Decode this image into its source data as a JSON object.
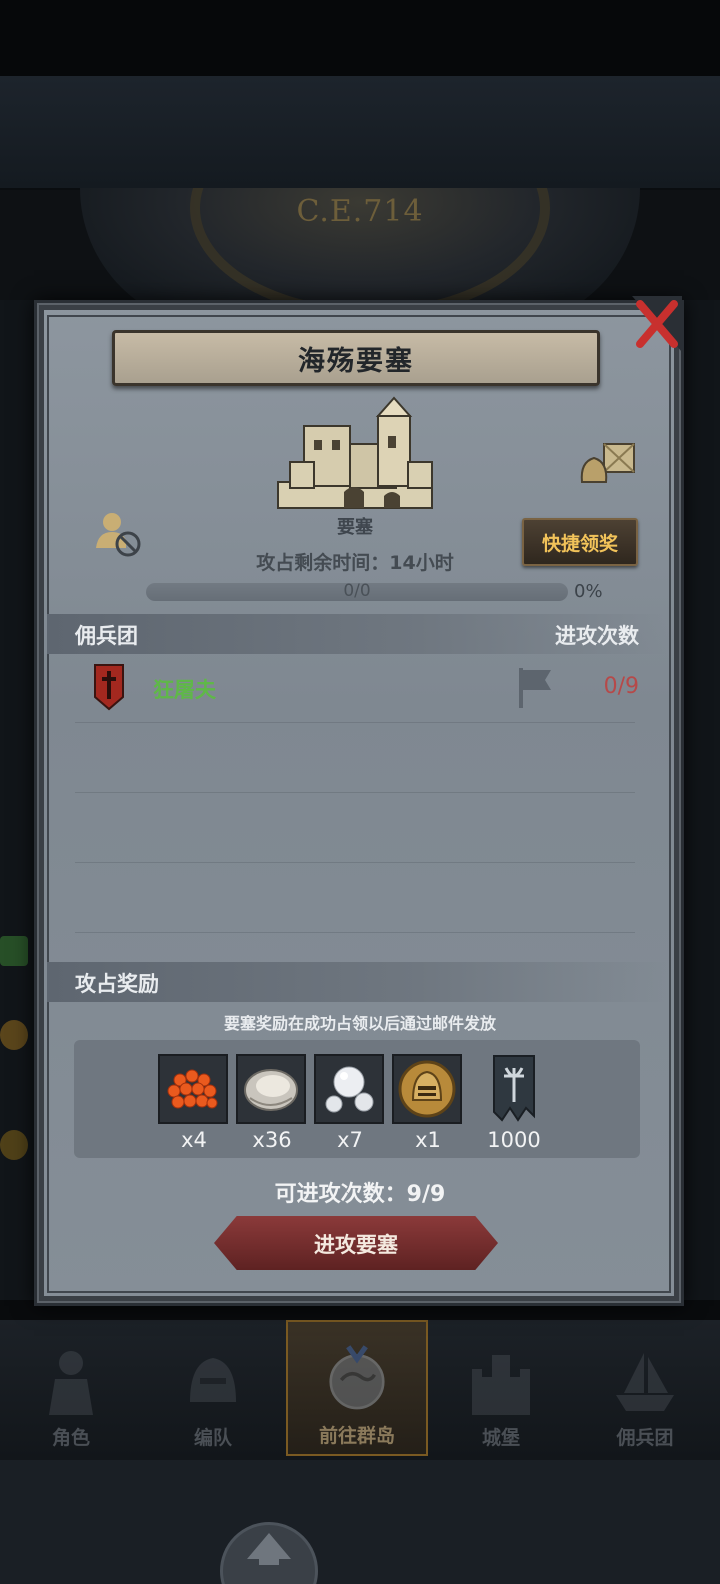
{
  "background": {
    "year_label": "C.E.714"
  },
  "nav": {
    "items": [
      {
        "label": "角色",
        "active": false
      },
      {
        "label": "编队",
        "active": false
      },
      {
        "label": "前往群岛",
        "active": true
      },
      {
        "label": "城堡",
        "active": false
      },
      {
        "label": "佣兵团",
        "active": false
      }
    ]
  },
  "modal": {
    "title": "海殇要塞",
    "castle_type": "要塞",
    "claim_button": "快捷领奖",
    "time_remaining": "攻占剩余时间：14小时",
    "progress": {
      "text": "0/0",
      "percent_label": "0%",
      "fraction": 0
    },
    "mercenary_section": {
      "title": "佣兵团",
      "right_title": "进攻次数",
      "rows": [
        {
          "name": "狂屠夫",
          "attacks": "0/9"
        }
      ]
    },
    "reward_section": {
      "title": "攻占奖励",
      "note": "要塞奖励在成功占领以后通过邮件发放",
      "items": [
        {
          "icon": "fish-roe-icon",
          "count": "x4"
        },
        {
          "icon": "oyster-icon",
          "count": "x36"
        },
        {
          "icon": "pearl-icon",
          "count": "x7"
        },
        {
          "icon": "knight-helmet-coin-icon",
          "count": "x1"
        },
        {
          "icon": "banner-icon",
          "count": "1000"
        }
      ]
    },
    "attack_count": "可进攻次数：9/9",
    "attack_button": "进攻要塞"
  },
  "colors": {
    "merc_name": "#5fb848",
    "attack_count_red": "#b64949",
    "claim_text": "#f2c35a"
  }
}
